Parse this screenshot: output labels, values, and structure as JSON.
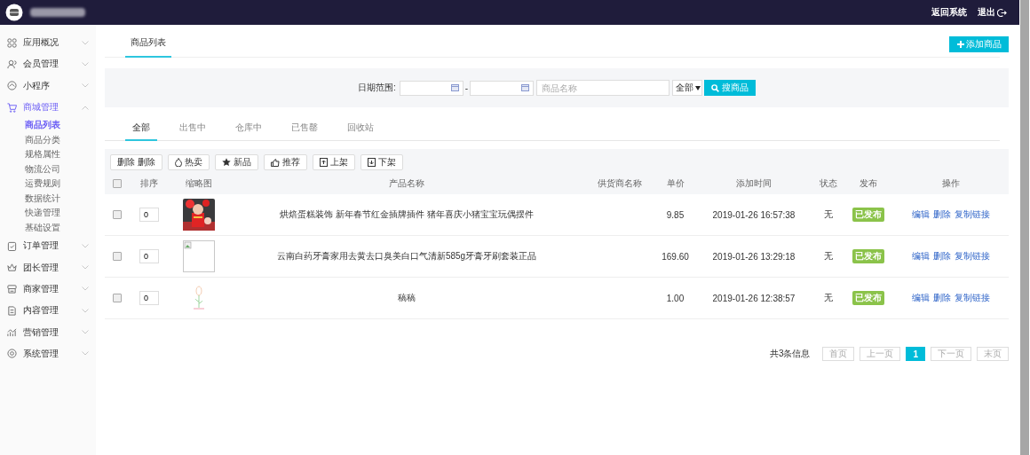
{
  "topbar": {
    "links": [
      {
        "label": "返回系统"
      },
      {
        "label": "退出"
      }
    ]
  },
  "sidebar": {
    "items": [
      {
        "label": "应用概况",
        "expanded": false,
        "selected": false
      },
      {
        "label": "会员管理",
        "expanded": false,
        "selected": false
      },
      {
        "label": "小程序",
        "expanded": false,
        "selected": false
      },
      {
        "label": "商城管理",
        "expanded": true,
        "selected": true,
        "children": [
          {
            "label": "商品列表",
            "selected": true
          },
          {
            "label": "商品分类",
            "selected": false
          },
          {
            "label": "规格属性",
            "selected": false
          },
          {
            "label": "物流公司",
            "selected": false
          },
          {
            "label": "运费规则",
            "selected": false
          },
          {
            "label": "数据统计",
            "selected": false
          },
          {
            "label": "快递管理",
            "selected": false
          },
          {
            "label": "基础设置",
            "selected": false
          }
        ]
      },
      {
        "label": "订单管理",
        "expanded": false,
        "selected": false
      },
      {
        "label": "团长管理",
        "expanded": false,
        "selected": false
      },
      {
        "label": "商家管理",
        "expanded": false,
        "selected": false
      },
      {
        "label": "内容管理",
        "expanded": false,
        "selected": false
      },
      {
        "label": "营销管理",
        "expanded": false,
        "selected": false
      },
      {
        "label": "系统管理",
        "expanded": false,
        "selected": false
      }
    ]
  },
  "header": {
    "tab": "商品列表",
    "add_button": "添加商品"
  },
  "filter": {
    "date_label": "日期范围:",
    "separator": "-",
    "name_placeholder": "商品名称",
    "select_value": "全部",
    "search_button": "搜商品"
  },
  "status_tabs": [
    {
      "label": "全部",
      "selected": true
    },
    {
      "label": "出售中",
      "selected": false
    },
    {
      "label": "仓库中",
      "selected": false
    },
    {
      "label": "已售罄",
      "selected": false
    },
    {
      "label": "回收站",
      "selected": false
    }
  ],
  "toolbar": [
    {
      "label": "删除 删除",
      "kind": "plain"
    },
    {
      "label": "热卖",
      "kind": "flame"
    },
    {
      "label": "新品",
      "kind": "star"
    },
    {
      "label": "推荐",
      "kind": "thumb"
    },
    {
      "label": "上架",
      "kind": "up"
    },
    {
      "label": "下架",
      "kind": "down"
    }
  ],
  "table": {
    "select_all_checked": false,
    "columns": [
      "排序",
      "缩略图",
      "产品名称",
      "供货商名称",
      "单价",
      "添加时间",
      "状态",
      "发布",
      "操作"
    ],
    "rows": [
      {
        "checked": false,
        "sort": "0",
        "name": "烘焙蛋糕装饰 新年春节红金插牌插件 猪年喜庆小猪宝宝玩偶摆件",
        "price": "9.85",
        "added": "2019-01-26 16:57:38",
        "status": "无",
        "publish": "已发布",
        "actions": [
          "编辑",
          "删除",
          "复制链接"
        ]
      },
      {
        "checked": false,
        "sort": "0",
        "thumbnail": {
          "kind": "broken"
        },
        "name": "云南白药牙膏家用去黄去口臭美白口气清新585g牙膏牙刷套装正品",
        "price": "169.60",
        "added": "2019-01-26 13:29:18",
        "status": "无",
        "publish": "已发布",
        "actions": [
          "编辑",
          "删除",
          "复制链接"
        ]
      },
      {
        "checked": false,
        "sort": "0",
        "thumbnail": {
          "kind": "sketch"
        },
        "name": "稿稿",
        "price": "1.00",
        "added": "2019-01-26 12:38:57",
        "status": "无",
        "publish": "已发布",
        "actions": [
          "编辑",
          "删除",
          "复制链接"
        ]
      }
    ]
  },
  "pagination": {
    "summary": "共3条信息",
    "pages": [
      {
        "label": "首页",
        "selected": false
      },
      {
        "label": "上一页",
        "selected": false
      },
      {
        "label": "1",
        "selected": true
      },
      {
        "label": "下一页",
        "selected": false
      },
      {
        "label": "末页",
        "selected": false
      }
    ]
  }
}
